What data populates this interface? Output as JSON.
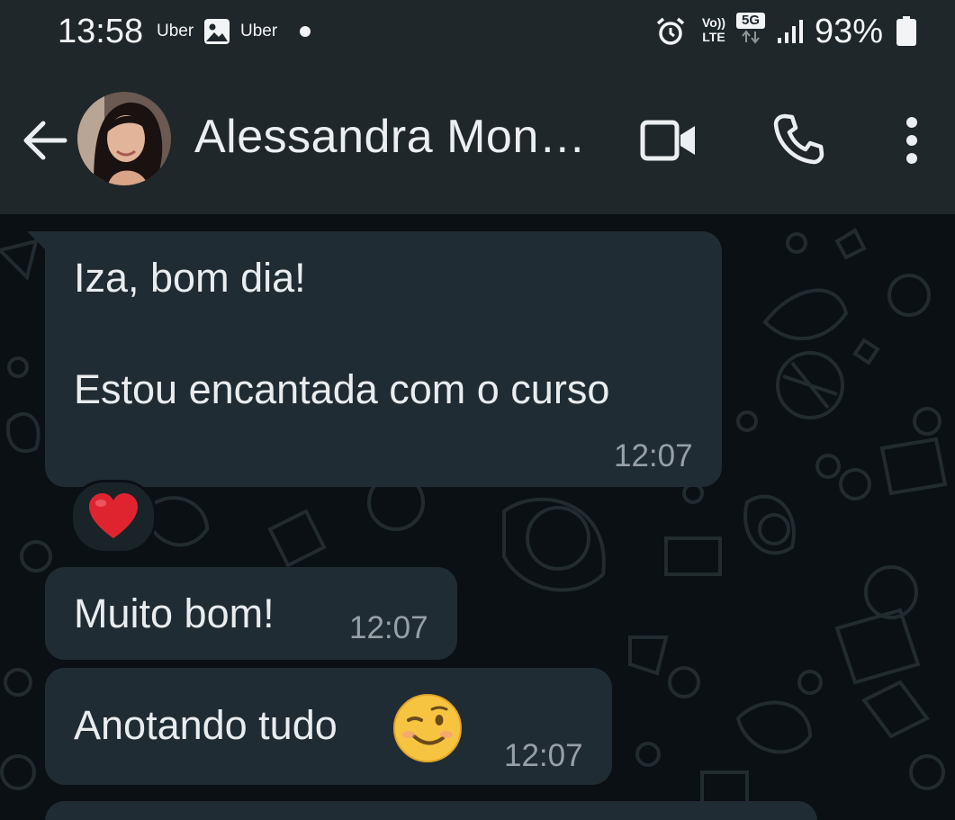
{
  "status_bar": {
    "time": "13:58",
    "notification_label_1": "Uber",
    "notification_label_2": "Uber",
    "volte_line1": "Vo))",
    "volte_line2": "LTE",
    "network": "5G",
    "battery": "93%"
  },
  "header": {
    "contact_name": "Alessandra Mon…",
    "icons": [
      "back-arrow-icon",
      "avatar",
      "video-call-icon",
      "phone-call-icon",
      "more-options-icon"
    ]
  },
  "messages": [
    {
      "line1": "Iza, bom dia!",
      "line2": "Estou encantada com o curso",
      "time": "12:07",
      "reaction": "❤️"
    },
    {
      "text": "Muito bom!",
      "time": "12:07"
    },
    {
      "text": "Anotando tudo",
      "emoji": "😉",
      "time": "12:07"
    }
  ],
  "colors": {
    "header_bg": "#1f272b",
    "chat_bg": "#0b1014",
    "bubble_bg": "#202c33",
    "text": "#e9edef",
    "timestamp": "#96a0a6"
  }
}
